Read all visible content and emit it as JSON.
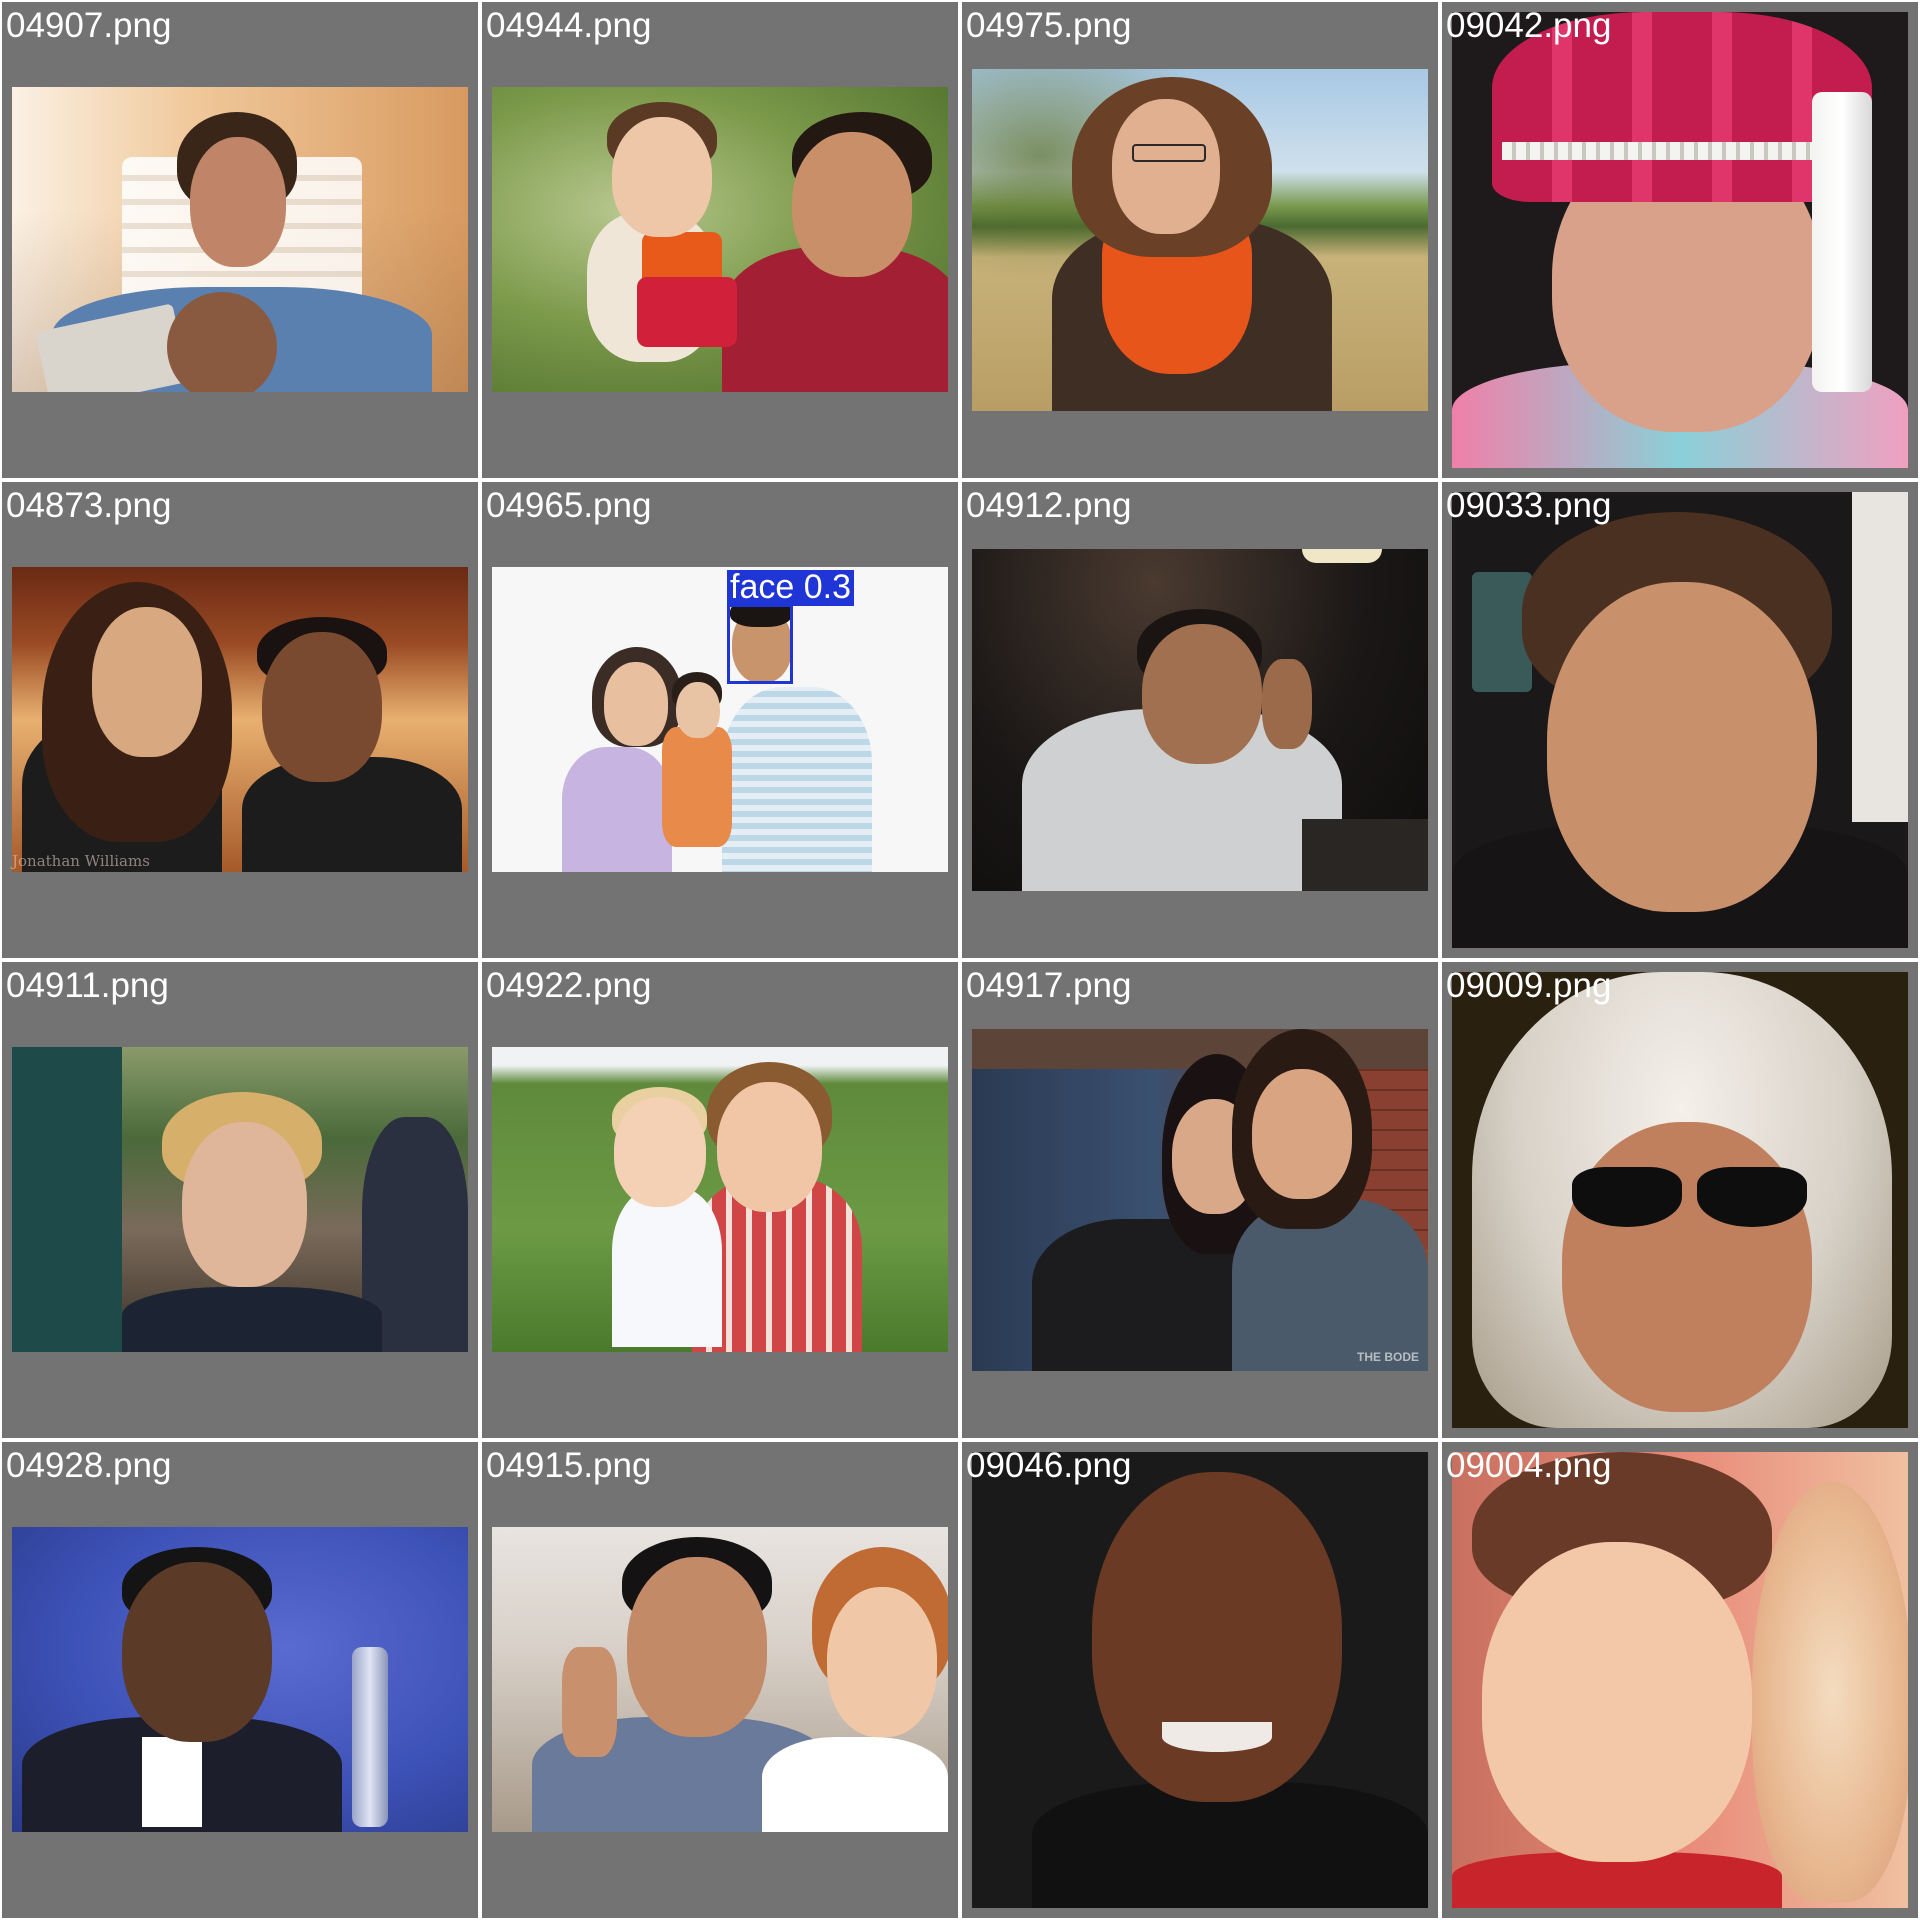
{
  "tiles": [
    {
      "filename": "04907.png",
      "subject": "man-reading-magazine",
      "colors": [
        "#f6e3c8",
        "#d08a4c",
        "#5a80b0",
        "#b98a6c"
      ]
    },
    {
      "filename": "04944.png",
      "subject": "man-holding-baby",
      "colors": [
        "#6d8a42",
        "#b8c890",
        "#a31f34",
        "#c98f68"
      ]
    },
    {
      "filename": "04975.png",
      "subject": "woman-with-glasses-in-field",
      "colors": [
        "#9ec0dc",
        "#c8b27a",
        "#e8551b",
        "#3e2e24"
      ]
    },
    {
      "filename": "09042.png",
      "subject": "woman-in-embroidered-hat",
      "colors": [
        "#c21d4e",
        "#1e1a1c",
        "#d9a08a",
        "#f3f3f0"
      ]
    },
    {
      "filename": "04873.png",
      "subject": "couple-portrait",
      "colors": [
        "#7c3a1c",
        "#e8b070",
        "#1c1c1c",
        "#c7916a"
      ]
    },
    {
      "filename": "04965.png",
      "subject": "family-on-white",
      "colors": [
        "#f7f7f7",
        "#c8b4e0",
        "#9fc4d8",
        "#3b2c26"
      ]
    },
    {
      "filename": "04912.png",
      "subject": "man-waving-at-table",
      "colors": [
        "#1a1716",
        "#cfd0d2",
        "#a07050",
        "#2a2624"
      ]
    },
    {
      "filename": "09033.png",
      "subject": "smiling-young-man-closeup",
      "colors": [
        "#2a2422",
        "#c9906c",
        "#4a3020",
        "#1a1818"
      ]
    },
    {
      "filename": "04911.png",
      "subject": "smiling-boy-outdoors",
      "colors": [
        "#4a6a3a",
        "#d6b06a",
        "#2a3040",
        "#e0b69a"
      ]
    },
    {
      "filename": "04922.png",
      "subject": "boy-holding-toddler",
      "colors": [
        "#5f8a3c",
        "#ffffff",
        "#d04646",
        "#f0c6a6"
      ]
    },
    {
      "filename": "04917.png",
      "subject": "two-women-portrait",
      "colors": [
        "#5c4538",
        "#2a3a52",
        "#1c1c1e",
        "#d9a888"
      ]
    },
    {
      "filename": "09009.png",
      "subject": "woman-in-fur-hat-sunglasses",
      "colors": [
        "#d8d2c8",
        "#2a2010",
        "#c0805e",
        "#f4f0ea"
      ]
    },
    {
      "filename": "04928.png",
      "subject": "man-on-blue-background",
      "colors": [
        "#3d52b8",
        "#1c1e2c",
        "#5c3a28",
        "#ffffff"
      ]
    },
    {
      "filename": "04915.png",
      "subject": "man-and-woman-peace-sign",
      "colors": [
        "#e8e4e0",
        "#6a7a9a",
        "#c38a68",
        "#ffffff"
      ]
    },
    {
      "filename": "09046.png",
      "subject": "smiling-man-closeup",
      "colors": [
        "#1a1a1a",
        "#6a3a24",
        "#111111",
        "#f0eae6"
      ]
    },
    {
      "filename": "09004.png",
      "subject": "boy-closeup-red-shirt",
      "colors": [
        "#e88a78",
        "#6a3a28",
        "#c8242c",
        "#f2c8a8"
      ]
    }
  ],
  "detection": {
    "label": "face 0.3",
    "color": "#1f35d6"
  },
  "watermarks": {
    "04873": "Jonathan Williams",
    "04917": "THE BODE"
  }
}
